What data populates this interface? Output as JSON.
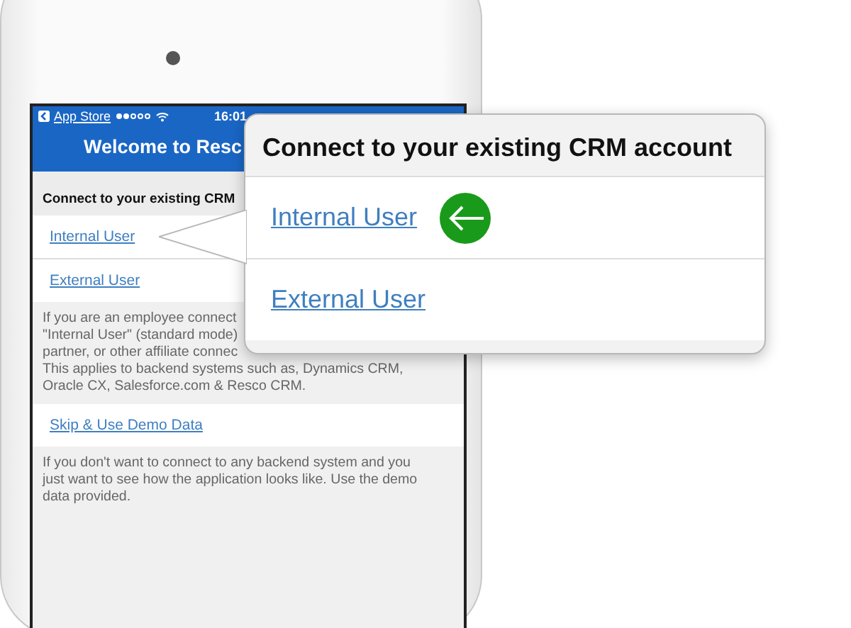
{
  "status_bar": {
    "back_label": "App Store",
    "time": "16:01"
  },
  "title": "Welcome to Resc",
  "section_header": "Connect to your existing CRM",
  "items": [
    {
      "kind": "link",
      "text": "Internal User"
    },
    {
      "kind": "link",
      "text": "External User"
    },
    {
      "kind": "note",
      "lines": [
        "If you are an employee connect",
        "\"Internal User\" (standard mode)",
        "partner, or other affiliate connec",
        "This applies to backend systems such as, Dynamics CRM,",
        "Oracle CX, Salesforce.com & Resco CRM."
      ]
    },
    {
      "kind": "link",
      "text": "Skip & Use Demo Data"
    },
    {
      "kind": "note",
      "lines": [
        "If you don't want to connect to any backend system and you",
        "just want to see how the application looks like. Use the demo",
        "data provided."
      ]
    }
  ],
  "callout": {
    "title": "Connect to your existing CRM account",
    "options": [
      {
        "text": "Internal User",
        "marked": true
      },
      {
        "text": "External User",
        "marked": false
      }
    ]
  }
}
